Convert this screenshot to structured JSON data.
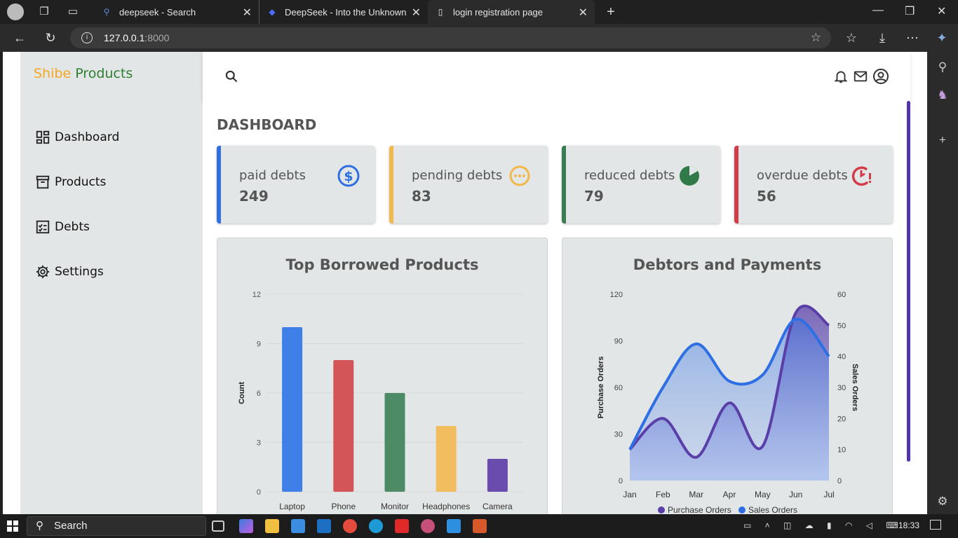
{
  "browser": {
    "tabs": [
      {
        "label": "deepseek - Search",
        "active": false
      },
      {
        "label": "DeepSeek - Into the Unknown",
        "active": false
      },
      {
        "label": "login registration page",
        "active": true
      }
    ],
    "url_host": "127.0.0.1",
    "url_port": ":8000"
  },
  "sidebar": {
    "brand_a": "Shibe",
    "brand_b": "Products",
    "items": [
      {
        "label": "Dashboard",
        "icon": "dashboard-icon"
      },
      {
        "label": "Products",
        "icon": "archive-icon"
      },
      {
        "label": "Debts",
        "icon": "checklist-icon"
      },
      {
        "label": "Settings",
        "icon": "gear-icon"
      }
    ]
  },
  "main": {
    "title": "DASHBOARD",
    "cards": [
      {
        "label": "paid debts",
        "value": "249",
        "color": "#2f6fe4",
        "icon": "dollar-icon"
      },
      {
        "label": "pending debts",
        "value": "83",
        "color": "#f2b84b",
        "icon": "pending-icon"
      },
      {
        "label": "reduced debts",
        "value": "79",
        "color": "#3a7d55",
        "icon": "pie-icon"
      },
      {
        "label": "overdue debts",
        "value": "56",
        "color": "#d33b48",
        "icon": "overdue-icon"
      }
    ]
  },
  "chart_data": [
    {
      "type": "bar",
      "title": "Top Borrowed Products",
      "ylabel": "Count",
      "xlabel": "",
      "categories": [
        "Laptop",
        "Phone",
        "Monitor",
        "Headphones",
        "Camera"
      ],
      "values": [
        10,
        8,
        6,
        4,
        2
      ],
      "colors": [
        "#3f7fe8",
        "#d45558",
        "#4d8a66",
        "#f2bd5e",
        "#6a4bae"
      ],
      "ylim": [
        0,
        12
      ],
      "yticks": [
        0,
        3,
        6,
        9,
        12
      ],
      "grid": true
    },
    {
      "type": "area",
      "title": "Debtors and Payments",
      "categories": [
        "Jan",
        "Feb",
        "Mar",
        "Apr",
        "May",
        "Jun",
        "Jul"
      ],
      "series": [
        {
          "name": "Purchase Orders",
          "axis": "left",
          "values": [
            20,
            40,
            15,
            50,
            22,
            108,
            100
          ],
          "color": "#5a3fa8"
        },
        {
          "name": "Sales Orders",
          "axis": "right",
          "values": [
            10,
            30,
            44,
            32,
            34,
            52,
            40
          ],
          "color": "#2f6fe4"
        }
      ],
      "ylabel_left": "Purchase Orders",
      "ylabel_right": "Sales Orders",
      "ylim_left": [
        0,
        120
      ],
      "yticks_left": [
        0,
        30,
        60,
        90,
        120
      ],
      "ylim_right": [
        0,
        60
      ],
      "yticks_right": [
        0,
        10,
        20,
        30,
        40,
        50,
        60
      ],
      "legend": "bottom"
    }
  ],
  "taskbar": {
    "search": "Search",
    "time": "18:33"
  }
}
